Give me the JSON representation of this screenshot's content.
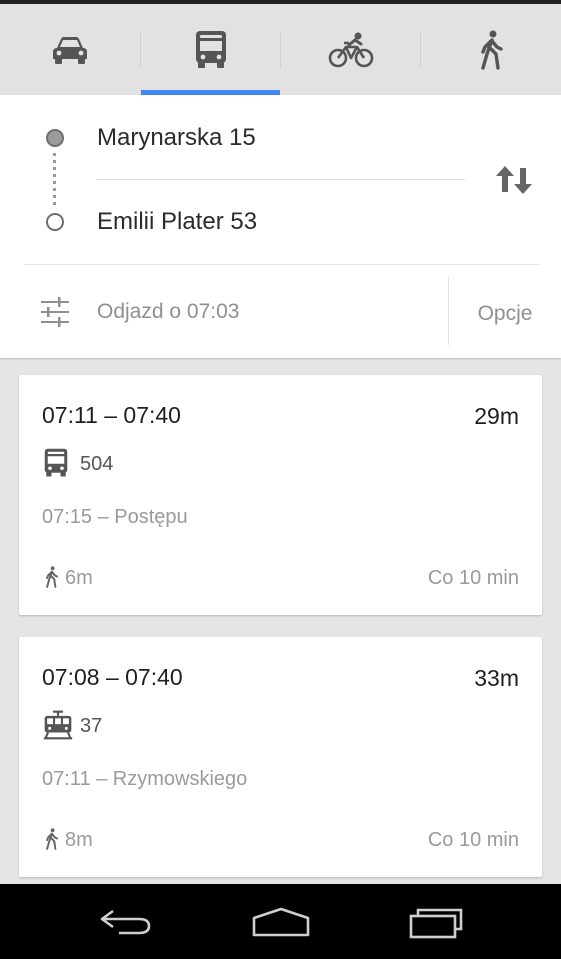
{
  "modes": [
    {
      "name": "car",
      "icon": "car-icon",
      "selected": false
    },
    {
      "name": "transit",
      "icon": "bus-icon",
      "selected": true
    },
    {
      "name": "bike",
      "icon": "bicycle-icon",
      "selected": false
    },
    {
      "name": "walk",
      "icon": "walking-icon",
      "selected": false
    }
  ],
  "route": {
    "origin": "Marynarska 15",
    "destination": "Emilii Plater 53",
    "departure": "Odjazd o 07:03",
    "options_label": "Opcje"
  },
  "results": [
    {
      "time": "07:11 – 07:40",
      "duration": "29m",
      "vehicle_icon": "bus-icon",
      "line": "504",
      "stop": "07:15 – Postępu",
      "walk": "6m",
      "frequency": "Co 10 min"
    },
    {
      "time": "07:08 – 07:40",
      "duration": "33m",
      "vehicle_icon": "tram-icon",
      "line": "37",
      "stop": "07:11 – Rzymowskiego",
      "walk": "8m",
      "frequency": "Co 10 min"
    }
  ],
  "colors": {
    "accent": "#4285f4",
    "icon_gray": "#5a5a5a",
    "muted_text": "#9a9a9a"
  }
}
